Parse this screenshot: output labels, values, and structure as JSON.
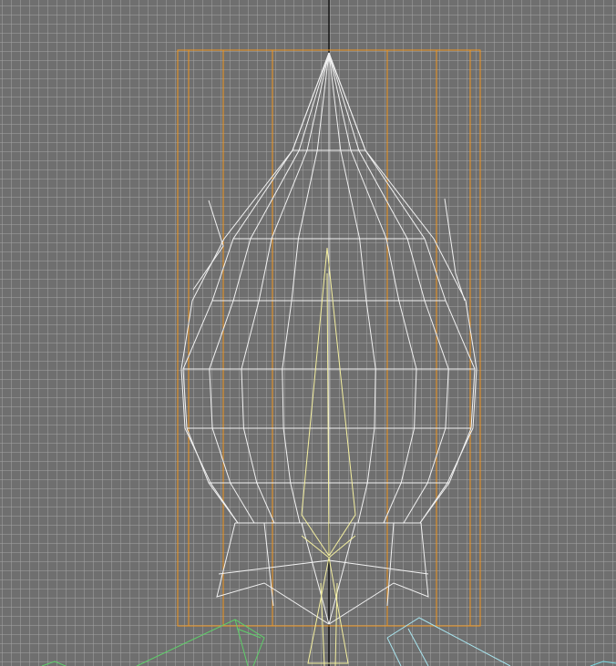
{
  "viewport": {
    "label": "",
    "background_color": "#6f6f6f",
    "grid_color": "#a9a9a9",
    "axis_color": "#000000",
    "colors": {
      "bounding_box": "#f0961e",
      "mesh_main": "#f2f2f2",
      "mesh_center_spike": "#f5f0a0",
      "mesh_left_fin": "#5fd06a",
      "mesh_right_fin": "#a8e4ee",
      "mesh_edge_fin": "#7fd8e0"
    },
    "objects": [
      {
        "name": "bounding-box",
        "selected": true
      },
      {
        "name": "main-body-wireframe",
        "selected": false
      },
      {
        "name": "center-spike-wireframe",
        "selected": false
      },
      {
        "name": "left-fin-wireframe",
        "selected": false
      },
      {
        "name": "right-fin-wireframe",
        "selected": false
      }
    ]
  }
}
